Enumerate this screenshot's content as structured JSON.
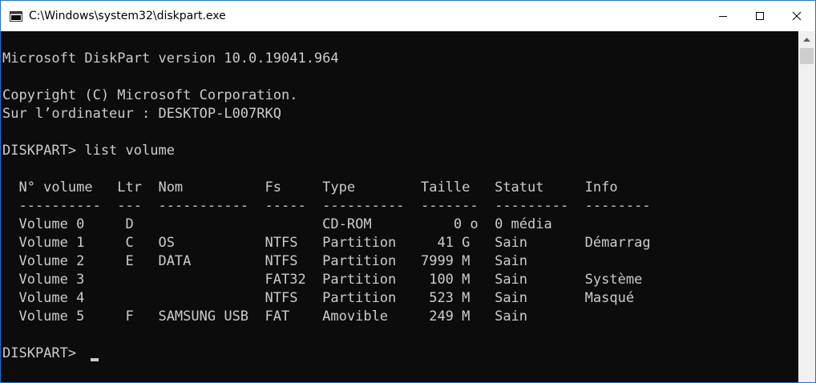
{
  "window": {
    "title": "C:\\Windows\\system32\\diskpart.exe",
    "icon": "console-app-icon",
    "controls": [
      "minimize-icon",
      "maximize-icon",
      "close-icon"
    ]
  },
  "console": {
    "lines": [
      "Microsoft DiskPart version 10.0.19041.964",
      "",
      "Copyright (C) Microsoft Corporation.",
      "Sur l’ordinateur : DESKTOP-L007RKQ",
      "",
      "DISKPART> list volume",
      "",
      "  N° volume   Ltr  Nom          Fs     Type        Taille   Statut     Info",
      "  ----------  ---  -----------  -----  ----------  -------  ---------  --------",
      "  Volume 0     D                       CD-ROM          0 o  0 média",
      "  Volume 1     C   OS           NTFS   Partition     41 G   Sain       Démarrag",
      "  Volume 2     E   DATA         NTFS   Partition   7999 M   Sain",
      "  Volume 3                      FAT32  Partition    100 M   Sain       Système",
      "  Volume 4                      NTFS   Partition    523 M   Sain       Masqué",
      "  Volume 5     F   SAMSUNG USB  FAT    Amovible     249 M   Sain",
      "",
      "DISKPART> "
    ],
    "text_color": "#cccccc",
    "background": "#0c0c0c"
  }
}
